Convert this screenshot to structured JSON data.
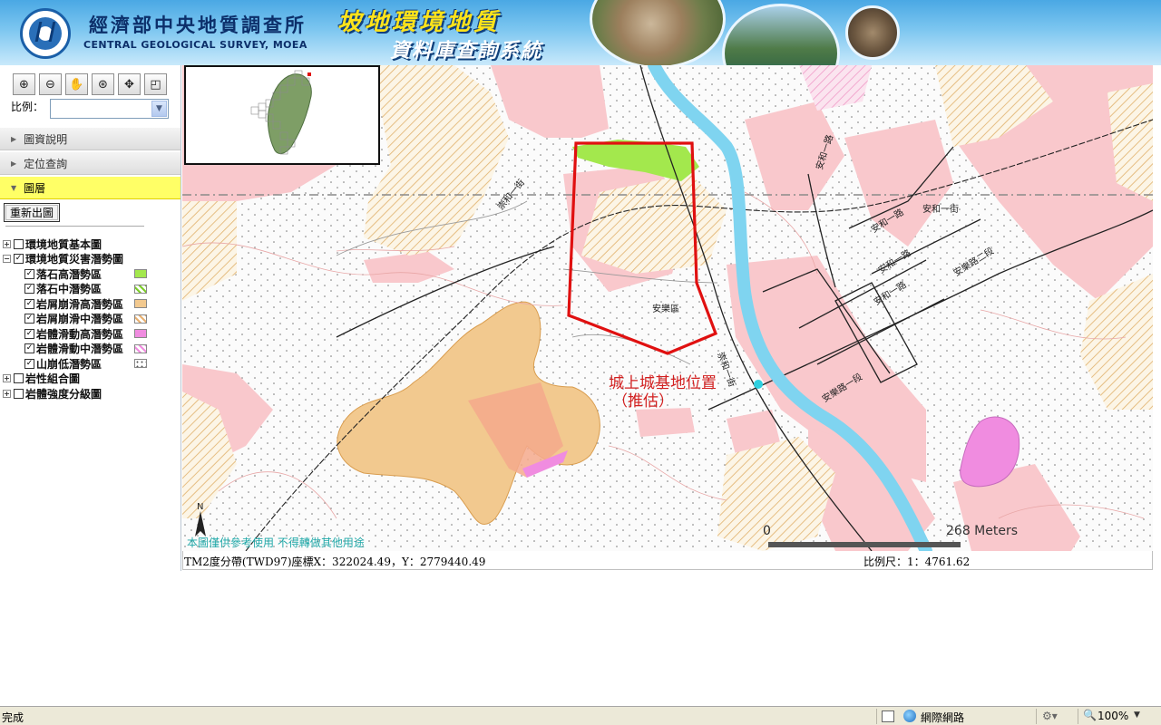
{
  "header": {
    "org_name_zh": "經濟部中央地質調查所",
    "org_name_en": "CENTRAL GEOLOGICAL SURVEY, MOEA",
    "title_line1": "坡地環境地質",
    "title_line2": "資料庫查詢系統"
  },
  "toolbar": {
    "tools": [
      {
        "name": "zoom-in-icon",
        "glyph": "⊕"
      },
      {
        "name": "zoom-out-icon",
        "glyph": "⊖"
      },
      {
        "name": "pan-hand-icon",
        "glyph": "✋"
      },
      {
        "name": "full-extent-icon",
        "glyph": "⊛"
      },
      {
        "name": "previous-extent-icon",
        "glyph": "✥"
      },
      {
        "name": "identify-icon",
        "glyph": "◰"
      }
    ],
    "scale_label": "比例：",
    "scale_value": ""
  },
  "panels": {
    "map_info": "圖資說明",
    "locate_query": "定位查詢",
    "layers": "圖層",
    "redraw_button": "重新出圖"
  },
  "layers": [
    {
      "label": "環境地質基本圖",
      "expanded": false,
      "checked": false,
      "children": []
    },
    {
      "label": "環境地質災害潛勢圖",
      "expanded": true,
      "checked": true,
      "children": [
        {
          "label": "落石高潛勢區",
          "checked": true,
          "swatch": "#a3e84d"
        },
        {
          "label": "落石中潛勢區",
          "checked": true,
          "swatch": "hatch-green"
        },
        {
          "label": "岩屑崩滑高潛勢區",
          "checked": true,
          "swatch": "#f2c98f"
        },
        {
          "label": "岩屑崩滑中潛勢區",
          "checked": true,
          "swatch": "hatch-orange"
        },
        {
          "label": "岩體滑動高潛勢區",
          "checked": true,
          "swatch": "#f08ce0"
        },
        {
          "label": "岩體滑動中潛勢區",
          "checked": true,
          "swatch": "hatch-pink"
        },
        {
          "label": "山崩低潛勢區",
          "checked": true,
          "swatch": "dots"
        }
      ]
    },
    {
      "label": "岩性組合圖",
      "expanded": false,
      "checked": false,
      "children": []
    },
    {
      "label": "岩體強度分級圖",
      "expanded": false,
      "checked": false,
      "children": []
    }
  ],
  "map": {
    "disclaimer": "本圖僅供參考使用 不得轉做其他用途",
    "site_label_line1": "城上城基地位置",
    "site_label_line2": "（推估）",
    "district_label": "安樂區",
    "roads": {
      "a": "崇和一街",
      "b": "安和一路",
      "c": "安和一街",
      "d": "安和一路",
      "e": "安和一路",
      "f": "安和一路",
      "g": "安樂路二段",
      "h": "安樂路一段",
      "i": "崇和一街"
    },
    "north_label": "N",
    "scalebar_zero": "0",
    "scalebar_distance": "268 Meters",
    "colors": {
      "river": "#7fd4f0",
      "site_outline": "#e01010",
      "rockfall_high": "#a3e84d",
      "debris_high": "#f2c98f",
      "rock_slide_high": "#f08ce0",
      "developed": "#f9c8cc"
    }
  },
  "coord_bar": {
    "coordinates": "TM2度分帶(TWD97)座標X：322024.49，Y：2779440.49",
    "scale": "比例尺：1：4761.62"
  },
  "browser_status": {
    "text": "完成",
    "zone": "網際網路",
    "zoom": "100%"
  }
}
